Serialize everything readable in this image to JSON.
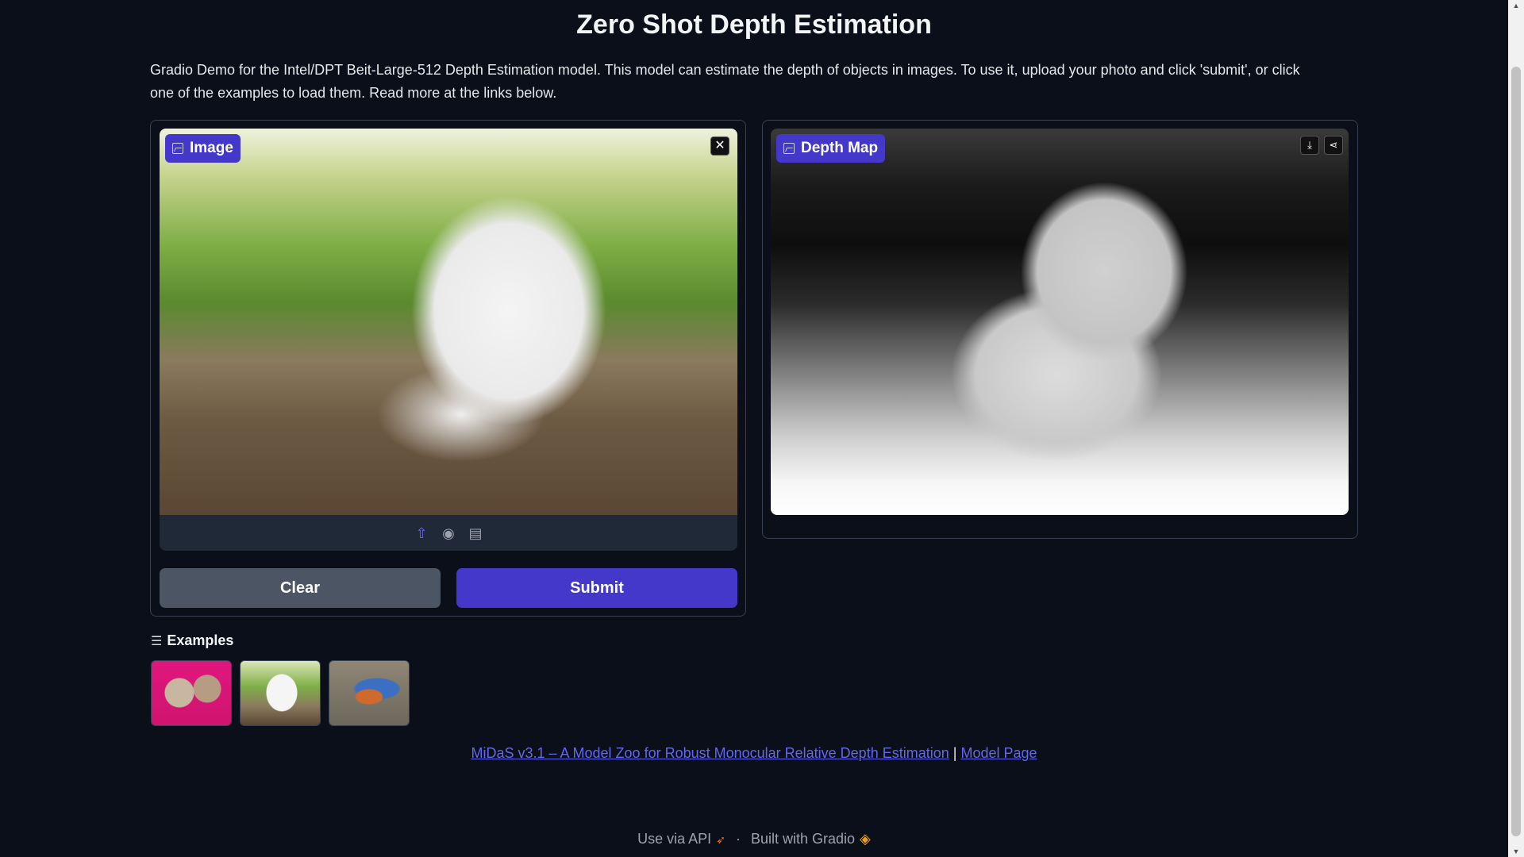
{
  "header": {
    "title": "Zero Shot Depth Estimation",
    "description": "Gradio Demo for the Intel/DPT Beit-Large-512 Depth Estimation model. This model can estimate the depth of objects in images. To use it, upload your photo and click 'submit', or click one of the examples to load them. Read more at the links below."
  },
  "input": {
    "label": "Image",
    "close_glyph": "✕",
    "toolbar_icons": [
      "upload-icon",
      "webcam-icon",
      "clipboard-icon"
    ]
  },
  "output": {
    "label": "Depth Map",
    "download_glyph": "⤓",
    "share_glyph": "⋖"
  },
  "buttons": {
    "clear": "Clear",
    "submit": "Submit"
  },
  "examples": {
    "label": "Examples",
    "items": [
      "cats on pink blanket",
      "white puppy",
      "bluebird in flight"
    ]
  },
  "links": {
    "midas": "MiDaS v3.1 – A Model Zoo for Robust Monocular Relative Depth Estimation",
    "separator": "|",
    "model_page": "Model Page"
  },
  "footer": {
    "api": "Use via API",
    "dot": "·",
    "built": "Built with Gradio"
  },
  "colors": {
    "background": "#0b0f19",
    "accent": "#4338ca",
    "link": "#6366f1"
  }
}
